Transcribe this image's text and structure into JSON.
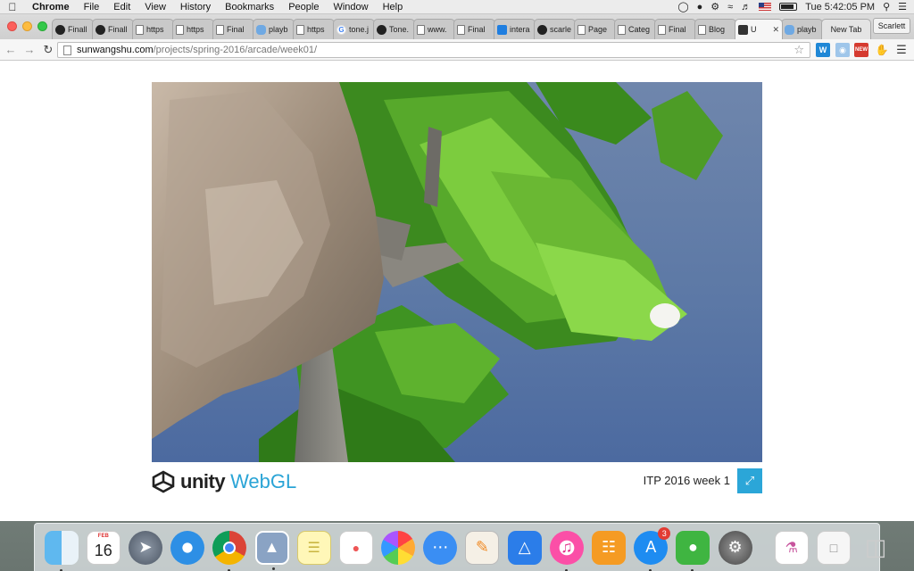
{
  "menubar": {
    "app_name": "Chrome",
    "menus": [
      "File",
      "Edit",
      "View",
      "History",
      "Bookmarks",
      "People",
      "Window",
      "Help"
    ],
    "clock": "Tue 5:42:05 PM"
  },
  "tabs": [
    {
      "label": "Finall",
      "icon": "github-icon"
    },
    {
      "label": "Finall",
      "icon": "github-icon"
    },
    {
      "label": "https",
      "icon": "page-icon"
    },
    {
      "label": "https",
      "icon": "page-icon"
    },
    {
      "label": "Final",
      "icon": "page-icon"
    },
    {
      "label": "playb",
      "icon": "cloud-icon"
    },
    {
      "label": "https",
      "icon": "page-icon"
    },
    {
      "label": "tone.j",
      "icon": "google-icon"
    },
    {
      "label": "Tone.",
      "icon": "github-icon"
    },
    {
      "label": "www.",
      "icon": "page-icon"
    },
    {
      "label": "Final",
      "icon": "page-icon"
    },
    {
      "label": "intera",
      "icon": "dropbox-icon"
    },
    {
      "label": "scarle",
      "icon": "github-icon"
    },
    {
      "label": "Page",
      "icon": "page-icon"
    },
    {
      "label": "Categ",
      "icon": "page-icon"
    },
    {
      "label": "Final",
      "icon": "page-icon"
    },
    {
      "label": "Blog",
      "icon": "page-icon"
    },
    {
      "label": "U",
      "icon": "unity-icon",
      "active": true
    },
    {
      "label": "playb",
      "icon": "cloud-icon"
    },
    {
      "label": "New Tab",
      "icon": ""
    }
  ],
  "profile_name": "Scarlett",
  "toolbar": {
    "url_host": "sunwangshu.com",
    "url_path": "/projects/spring-2016/arcade/week01/",
    "ext_badge": "NEW"
  },
  "game": {
    "engine_name": "unity",
    "engine_tech": "WebGL",
    "title": "ITP 2016 week 1"
  },
  "dock": {
    "calendar_month": "FEB",
    "calendar_day": "16",
    "appstore_badge": "3"
  }
}
